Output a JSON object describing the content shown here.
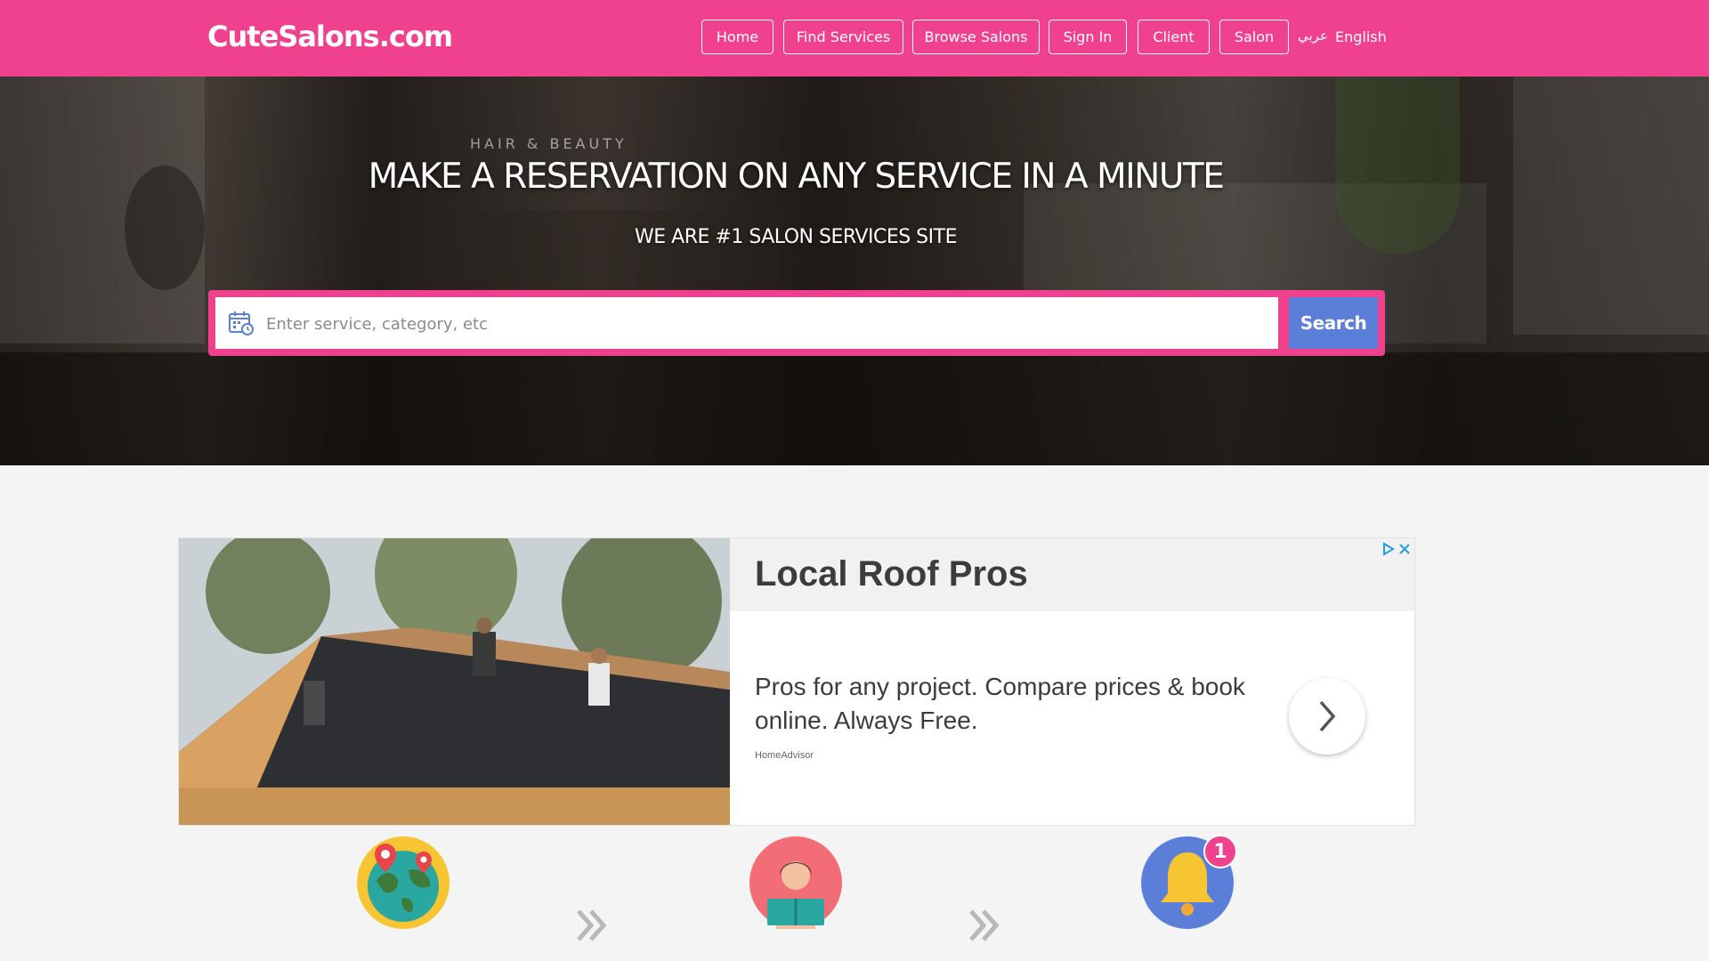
{
  "site": {
    "logo": "CuteSalons.com"
  },
  "nav": {
    "items": [
      {
        "label": "Home"
      },
      {
        "label": "Find Services"
      },
      {
        "label": "Browse Salons"
      },
      {
        "label": "Sign In"
      },
      {
        "label": "Client"
      },
      {
        "label": "Salon"
      }
    ],
    "lang_arabic": "عربي",
    "lang_english": "English"
  },
  "hero": {
    "title": "MAKE A RESERVATION ON ANY SERVICE IN A MINUTE",
    "subtitle": "WE ARE #1 SALON SERVICES SITE",
    "background_sign": "HAIR & BEAUTY"
  },
  "search": {
    "placeholder": "Enter service, category, etc",
    "value": "",
    "button_label": "Search"
  },
  "ad": {
    "title": "Local Roof Pros",
    "description": "Pros for any project. Compare prices & book online. Always Free.",
    "source": "HomeAdvisor"
  },
  "steps": {
    "icons": [
      "globe-location-icon",
      "person-reading-icon",
      "notification-bell-icon"
    ],
    "notification_count": "1"
  },
  "colors": {
    "brand_pink": "#f0418f",
    "search_blue": "#5b7fd9",
    "page_bg": "#f4f4f4"
  }
}
